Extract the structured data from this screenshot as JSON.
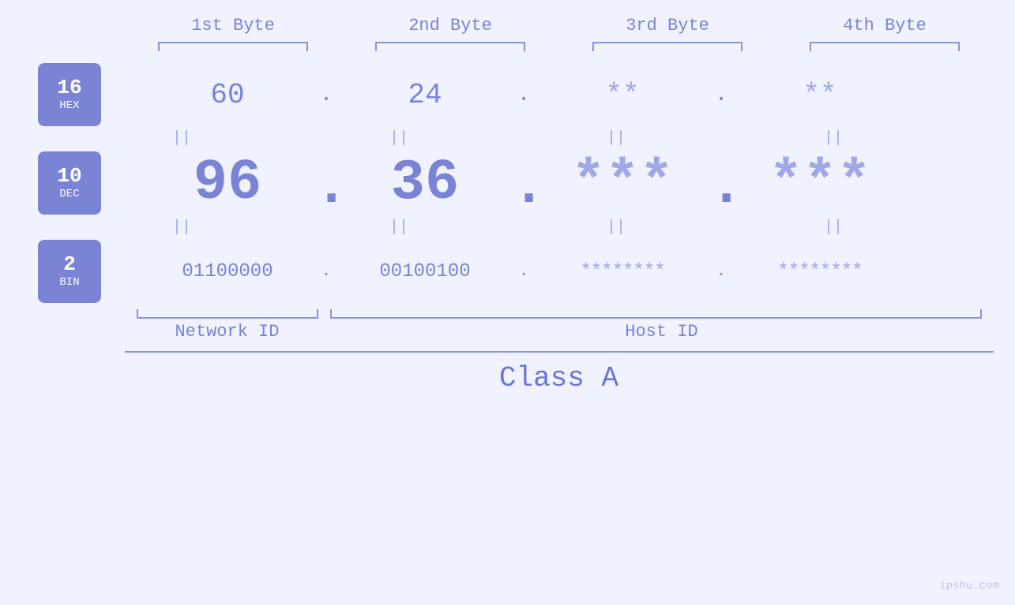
{
  "byteHeaders": {
    "b1": "1st Byte",
    "b2": "2nd Byte",
    "b3": "3rd Byte",
    "b4": "4th Byte"
  },
  "hex": {
    "badge_number": "16",
    "badge_label": "HEX",
    "b1": "60",
    "b2": "24",
    "b3": "**",
    "b4": "**"
  },
  "dec": {
    "badge_number": "10",
    "badge_label": "DEC",
    "b1": "96",
    "b2": "36",
    "b3": "***",
    "b4": "***"
  },
  "bin": {
    "badge_number": "2",
    "badge_label": "BIN",
    "b1": "01100000",
    "b2": "00100100",
    "b3": "********",
    "b4": "********"
  },
  "labels": {
    "network_id": "Network ID",
    "host_id": "Host ID",
    "class": "Class A"
  },
  "watermark": "ipshu.com",
  "dot": ".",
  "equals": "||"
}
